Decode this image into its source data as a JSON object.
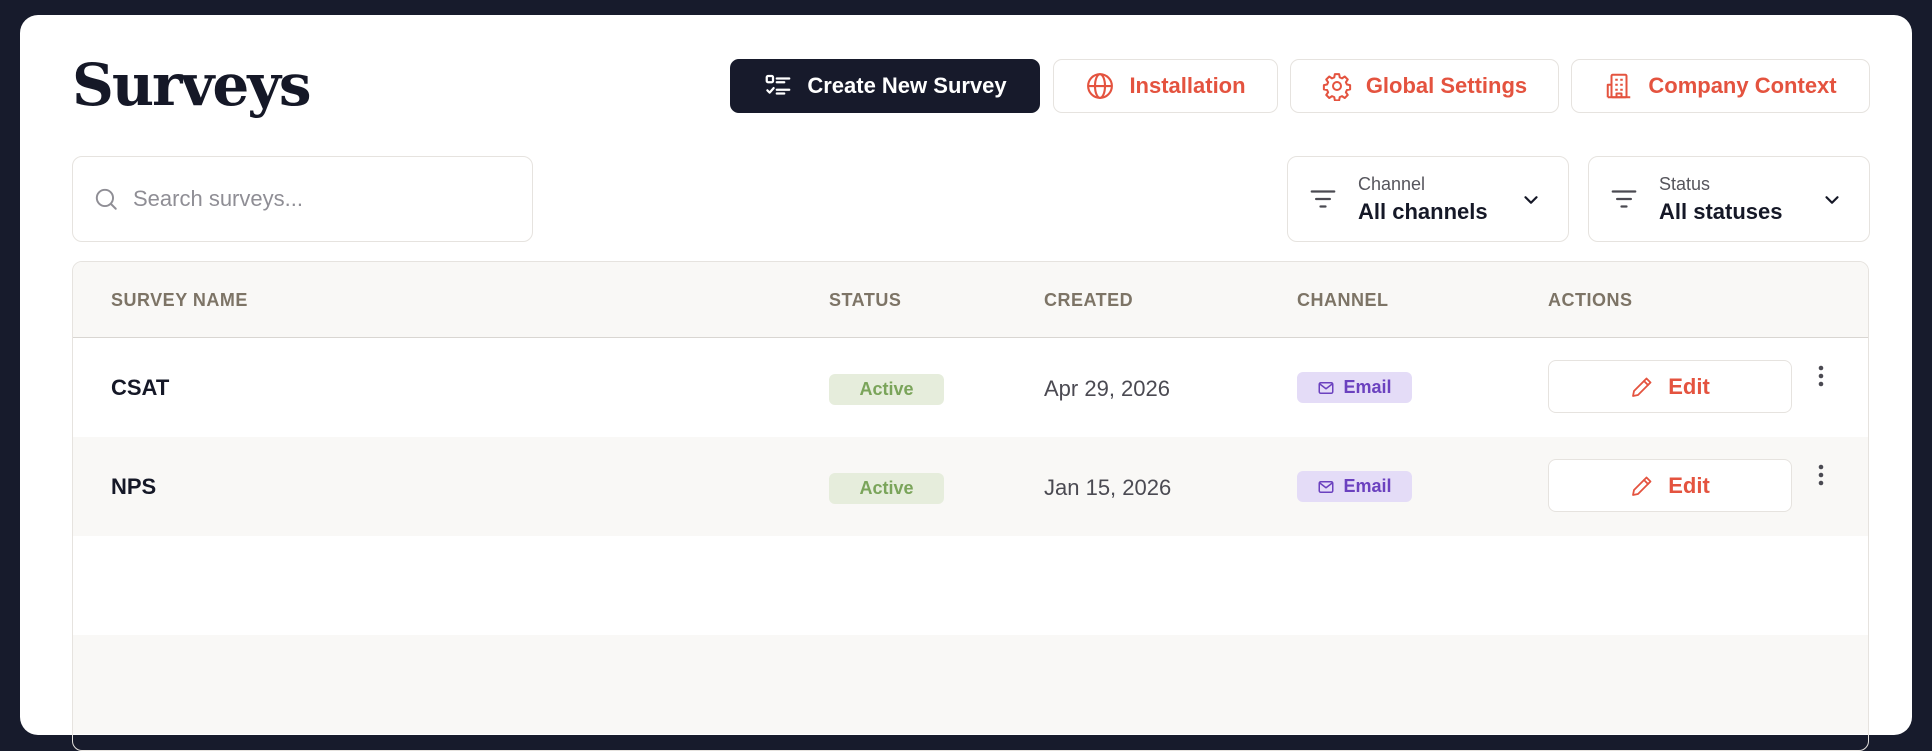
{
  "page": {
    "title": "Surveys"
  },
  "header": {
    "create_label": "Create New Survey",
    "installation_label": "Installation",
    "global_settings_label": "Global Settings",
    "company_context_label": "Company Context"
  },
  "search": {
    "placeholder": "Search surveys..."
  },
  "filters": {
    "channel": {
      "label": "Channel",
      "value": "All channels"
    },
    "status": {
      "label": "Status",
      "value": "All statuses"
    }
  },
  "table": {
    "columns": [
      "SURVEY NAME",
      "STATUS",
      "CREATED",
      "CHANNEL",
      "ACTIONS"
    ],
    "rows": [
      {
        "name": "CSAT",
        "status": "Active",
        "created": "Apr 29, 2026",
        "channel": "Email",
        "action": "Edit"
      },
      {
        "name": "NPS",
        "status": "Active",
        "created": "Jan 15, 2026",
        "channel": "Email",
        "action": "Edit"
      }
    ]
  },
  "colors": {
    "primary_dark": "#171a2b",
    "accent": "#e4533f",
    "status_active_bg": "#e6eddc",
    "status_active_text": "#7aa45a",
    "channel_bg": "#e4dcf7",
    "channel_text": "#6b41bf"
  },
  "icons": {
    "create": "checklist-icon",
    "installation": "globe-icon",
    "global_settings": "gear-icon",
    "company_context": "building-icon",
    "search": "search-icon",
    "filter": "filter-icon",
    "dropdown": "chevron-down-icon",
    "channel": "mail-icon",
    "edit": "pencil-icon",
    "more": "more-vertical-icon"
  }
}
